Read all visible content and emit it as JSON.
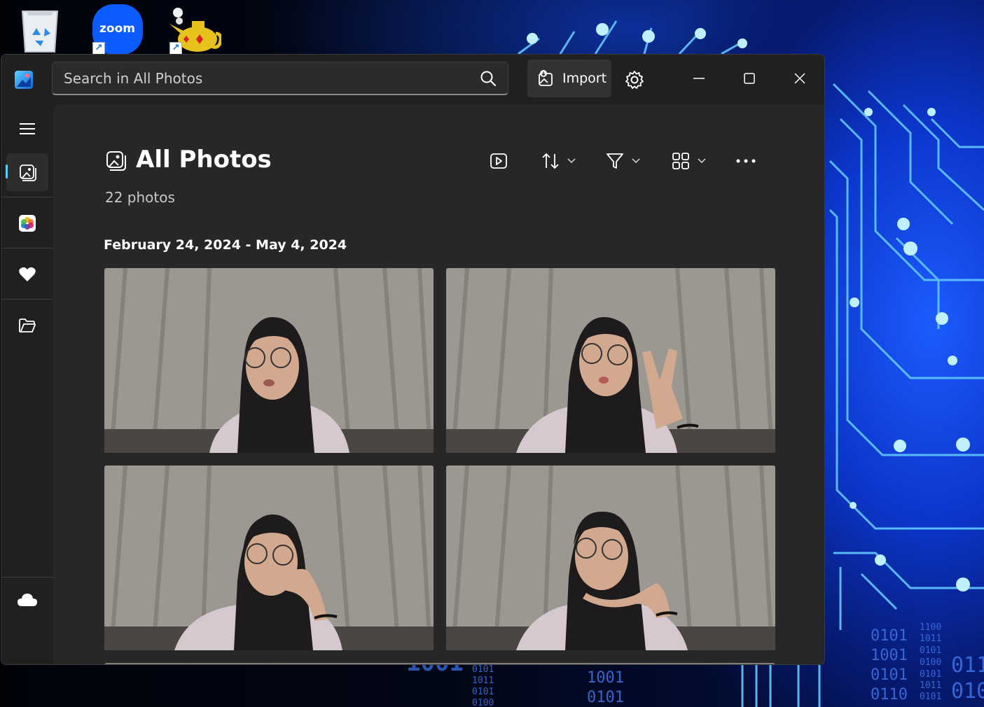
{
  "desktop": {
    "icons": [
      {
        "name": "Recycle Bin"
      },
      {
        "name": "Zoom",
        "label": "zoom"
      },
      {
        "name": "Genie"
      }
    ],
    "wallpaper_numbers": [
      "1001",
      "0101",
      "1011",
      "0101",
      "0100",
      "1001",
      "0101",
      "0101",
      "1001",
      "0101",
      "0110",
      "1100",
      "1011",
      "0101",
      "0100",
      "0101",
      "1011",
      "0101",
      "011",
      "010"
    ]
  },
  "window": {
    "search": {
      "placeholder": "Search in All Photos"
    },
    "import_label": "Import",
    "icons": {
      "app_logo": "photos-app-icon",
      "search": "search-icon",
      "import": "import-icon",
      "settings": "gear-icon",
      "minimize": "minimize-icon",
      "maximize": "maximize-icon",
      "close": "close-icon"
    }
  },
  "nav": {
    "items": [
      {
        "id": "menu",
        "icon": "hamburger-icon"
      },
      {
        "id": "all-photos",
        "icon": "photos-icon",
        "active": true
      },
      {
        "id": "icloud-photos",
        "icon": "icloud-photos-icon"
      },
      {
        "id": "favorites",
        "icon": "heart-icon"
      },
      {
        "id": "folders",
        "icon": "folder-icon"
      }
    ],
    "footer_icon": "cloud-icon"
  },
  "main": {
    "title": "All Photos",
    "count": "22 photos",
    "date_range": "February 24, 2024 - May 4, 2024",
    "toolbar": [
      "slideshow-icon",
      "sort-icon",
      "filter-icon",
      "view-icon",
      "more-icon"
    ]
  },
  "colors": {
    "accent": "#60cdff",
    "window_bg": "#202020",
    "content_bg": "#272727"
  }
}
